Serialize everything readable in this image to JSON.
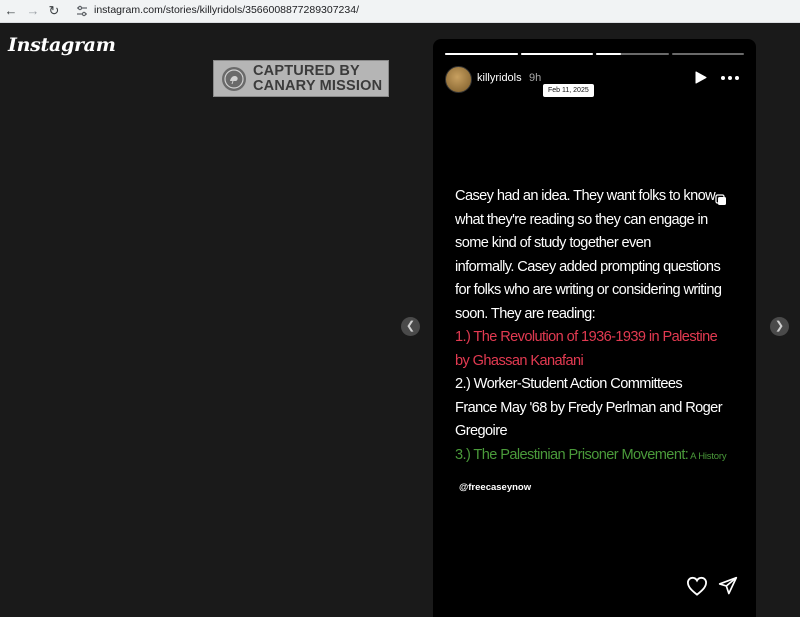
{
  "browser": {
    "url": "instagram.com/stories/killyridols/3566008877289307234/"
  },
  "app": {
    "logo_text": "Instagram"
  },
  "watermark": {
    "line1": "CAPTURED BY",
    "line2": "CANARY MISSION"
  },
  "story": {
    "username": "killyridols",
    "time_ago": "9h",
    "date_tooltip": "Feb 11, 2025",
    "progress_segments": [
      1.0,
      1.0,
      0.35,
      0.0
    ],
    "text_lines": [
      {
        "text": "Casey had an idea.  They want folks to know",
        "style": "white"
      },
      {
        "text": "what they're reading so they can engage in",
        "style": "white"
      },
      {
        "text": "some kind of study together even",
        "style": "white"
      },
      {
        "text": "informally.  Casey added prompting questions",
        "style": "white"
      },
      {
        "text": "for folks who are writing or considering writing",
        "style": "white"
      },
      {
        "text": "soon.  They are reading:",
        "style": "white"
      },
      {
        "text": "1.)  The Revolution of 1936-1939 in Palestine",
        "style": "red"
      },
      {
        "text": "by Ghassan Kanafani",
        "style": "red"
      },
      {
        "text": "2.)  Worker-Student Action Committees",
        "style": "white"
      },
      {
        "text": "France May '68 by Fredy Perlman and Roger",
        "style": "white"
      },
      {
        "text": "Gregoire",
        "style": "white"
      },
      {
        "text": "3.)  The Palestinian Prisoner Movement:",
        "style": "green",
        "suffix": " A History"
      }
    ],
    "mention": "@freecaseynow"
  },
  "icons": {
    "back": "back-arrow-icon",
    "forward": "forward-arrow-icon",
    "reload": "reload-icon",
    "site_settings": "tune-icon",
    "play": "play-icon",
    "more": "more-icon",
    "like": "heart-icon",
    "share": "send-icon",
    "prev": "chevron-left-icon",
    "next": "chevron-right-icon"
  },
  "colors": {
    "page_bg": "#1a1a1a",
    "story_bg": "#000000",
    "red_text": "#e23a51",
    "green_text": "#4a9a3a",
    "watermark_bg": "#b5b5b5"
  }
}
